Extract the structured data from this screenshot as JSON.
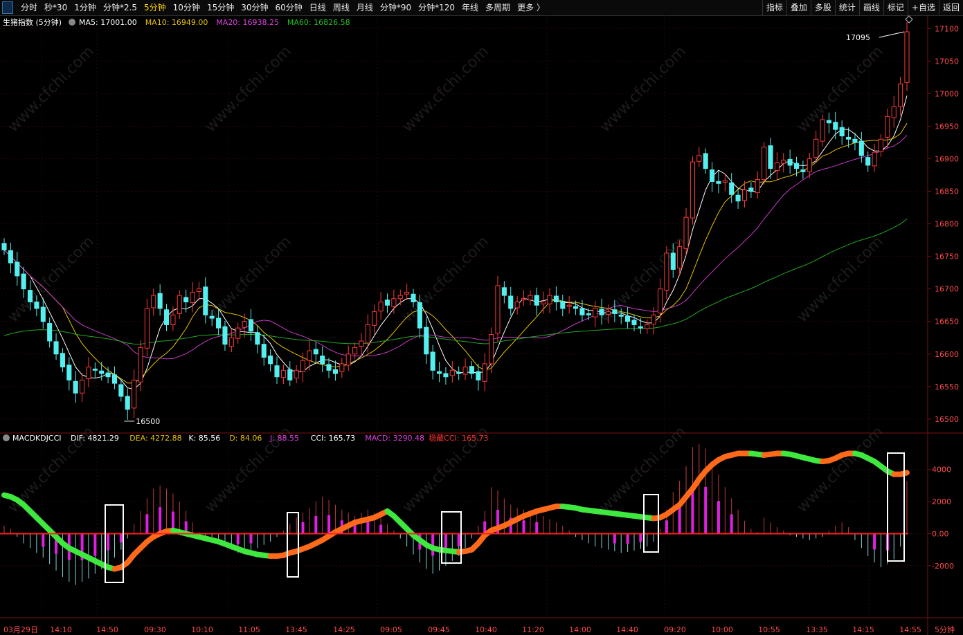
{
  "toolbar": {
    "periods": [
      "分时",
      "秒*30",
      "1分钟",
      "分钟*2.5",
      "5分钟",
      "10分钟",
      "15分钟",
      "30分钟",
      "60分钟",
      "日线",
      "周线",
      "月线",
      "分钟*90",
      "分钟*120",
      "年线",
      "多周期",
      "更多 〉"
    ],
    "active_period": "5分钟",
    "right_items": [
      "指标",
      "叠加",
      "多股",
      "统计",
      "画线",
      "标记",
      "+自选",
      "返回"
    ]
  },
  "main_panel": {
    "instrument": "生猪指数 (5分钟)",
    "ma_labels": [
      {
        "text": "MA5: 17001.00",
        "color": "#ffffff"
      },
      {
        "text": "MA10: 16949.00",
        "color": "#e6c300"
      },
      {
        "text": "MA20: 16938.25",
        "color": "#e040e0"
      },
      {
        "text": "MA60: 16826.58",
        "color": "#22c022"
      }
    ],
    "high_marker": "17095",
    "low_marker": "16500"
  },
  "indicator_panel": {
    "title": "MACDKDJCCI",
    "labels": [
      {
        "text": "DIF: 4821.29",
        "color": "#ffffff"
      },
      {
        "text": "DEA: 4272.88",
        "color": "#e6c300"
      },
      {
        "text": "K: 85.56",
        "color": "#ffffff"
      },
      {
        "text": "D: 84.06",
        "color": "#e6c300"
      },
      {
        "text": "J: 88.55",
        "color": "#e040e0"
      },
      {
        "text": "CCI: 165.73",
        "color": "#ffffff"
      },
      {
        "text": "MACD: 3290.48",
        "color": "#e040e0"
      },
      {
        "text": "稳藏CCI: 165.73",
        "color": "#ff3030"
      }
    ]
  },
  "x_axis": {
    "labels": [
      "03月29日",
      "14:10",
      "14:50",
      "09:30",
      "10:10",
      "11:05",
      "13:45",
      "14:25",
      "09:05",
      "09:45",
      "10:40",
      "11:20",
      "14:00",
      "14:40",
      "09:20",
      "10:00",
      "10:55",
      "13:35",
      "14:15",
      "14:55"
    ],
    "period_label": "5分钟"
  },
  "chart_data": {
    "type": "candlestick",
    "title": "生猪指数 (5分钟)",
    "price_axis_ticks": [
      16500,
      16550,
      16600,
      16650,
      16700,
      16750,
      16800,
      16850,
      16900,
      16950,
      17000,
      17050,
      17100
    ],
    "price_range": [
      16485,
      17112
    ],
    "indicator_axis_ticks": [
      4000,
      2000,
      0.0,
      -2000
    ],
    "indicator_tick_labels": [
      "4000",
      "2000",
      "0.00",
      "-2000"
    ],
    "indicator_range": [
      -5200,
      5800
    ],
    "close": [
      16760,
      16740,
      16720,
      16700,
      16680,
      16670,
      16650,
      16620,
      16600,
      16580,
      16560,
      16540,
      16560,
      16580,
      16575,
      16570,
      16565,
      16555,
      16535,
      16515,
      16560,
      16610,
      16670,
      16690,
      16670,
      16645,
      16660,
      16690,
      16680,
      16695,
      16700,
      16660,
      16655,
      16640,
      16615,
      16625,
      16640,
      16650,
      16635,
      16615,
      16595,
      16585,
      16565,
      16575,
      16560,
      16575,
      16590,
      16605,
      16600,
      16585,
      16575,
      16570,
      16585,
      16600,
      16610,
      16620,
      16645,
      16665,
      16680,
      16675,
      16685,
      16690,
      16695,
      16680,
      16640,
      16600,
      16575,
      16570,
      16565,
      16575,
      16570,
      16580,
      16570,
      16560,
      16585,
      16630,
      16705,
      16690,
      16670,
      16680,
      16685,
      16690,
      16675,
      16680,
      16690,
      16680,
      16670,
      16675,
      16670,
      16660,
      16660,
      16670,
      16660,
      16665,
      16662,
      16658,
      16650,
      16645,
      16640,
      16645,
      16660,
      16700,
      16755,
      16730,
      16765,
      16810,
      16895,
      16905,
      16885,
      16865,
      16862,
      16866,
      16845,
      16835,
      16852,
      16850,
      16868,
      16918,
      16885,
      16894,
      16898,
      16890,
      16885,
      16880,
      16900,
      16930,
      16960,
      16955,
      16945,
      16935,
      16930,
      16925,
      16905,
      16890,
      16910,
      16930,
      16965,
      16980,
      17015,
      17095
    ],
    "volume_note": "",
    "ma60_start": 16625,
    "indicator_series_note": "MACD histogram approximated from chart",
    "macd_hist": [
      500,
      300,
      -200,
      -600,
      -900,
      -1200,
      -1500,
      -1900,
      -2300,
      -2700,
      -3000,
      -3200,
      -3000,
      -2800,
      -2500,
      -2200,
      -1900,
      -1500,
      -1000,
      -300,
      600,
      1400,
      2200,
      2800,
      3000,
      2800,
      2500,
      2000,
      1400,
      700,
      100,
      -100,
      -200,
      -400,
      -700,
      -1000,
      -1200,
      -1300,
      -1100,
      -900,
      -700,
      -500,
      -200,
      200,
      600,
      1000,
      1300,
      1600,
      2000,
      2300,
      2100,
      1800,
      1500,
      1300,
      1100,
      1300,
      1500,
      1300,
      1000,
      600,
      200,
      -300,
      -800,
      -1300,
      -1800,
      -2200,
      -2500,
      -2300,
      -2000,
      -1700,
      -1400,
      -900,
      -300,
      500,
      1400,
      2900,
      2700,
      2200,
      1800,
      1600,
      1500,
      1400,
      1300,
      1100,
      900,
      700,
      500,
      200,
      -200,
      -400,
      -600,
      -800,
      -900,
      -1000,
      -1100,
      -1200,
      -1150,
      -1050,
      -950,
      -800,
      -500,
      300,
      1500,
      2600,
      3300,
      4200,
      5400,
      5600,
      5300,
      4500,
      3700,
      2900,
      2200,
      1500,
      800,
      300,
      100,
      1000,
      700,
      400,
      200,
      -100,
      -200,
      -300,
      -400,
      -300,
      -200,
      200,
      500,
      700,
      400,
      -400,
      -900,
      -1400,
      -1800,
      -2100,
      -1900,
      -1600,
      -800,
      3290
    ],
    "dif": [
      2400,
      2300,
      2100,
      1800,
      1400,
      1000,
      600,
      200,
      -200,
      -600,
      -900,
      -1100,
      -1300,
      -1500,
      -1700,
      -1900,
      -2100,
      -2200,
      -2100,
      -1800,
      -1300,
      -900,
      -500,
      -200,
      0,
      150,
      200,
      100,
      0,
      -100,
      -200,
      -300,
      -400,
      -500,
      -650,
      -800,
      -950,
      -1100,
      -1200,
      -1300,
      -1350,
      -1400,
      -1400,
      -1350,
      -1200,
      -1100,
      -950,
      -800,
      -600,
      -400,
      -150,
      100,
      300,
      500,
      700,
      800,
      900,
      1000,
      1200,
      1400,
      1100,
      700,
      300,
      -100,
      -400,
      -700,
      -900,
      -1000,
      -1050,
      -1100,
      -1150,
      -1100,
      -1000,
      -600,
      -100,
      200,
      350,
      500,
      700,
      900,
      1100,
      1250,
      1400,
      1500,
      1600,
      1700,
      1700,
      1650,
      1600,
      1500,
      1450,
      1400,
      1350,
      1300,
      1250,
      1200,
      1150,
      1100,
      1050,
      1000,
      950,
      1000,
      1200,
      1500,
      1800,
      2300,
      2800,
      3400,
      3900,
      4300,
      4600,
      4800,
      4900,
      5000,
      5000,
      5000,
      4950,
      4900,
      4950,
      5000,
      5000,
      4950,
      4850,
      4750,
      4650,
      4550,
      4500,
      4550,
      4700,
      4900,
      5000,
      5000,
      4900,
      4700,
      4500,
      4200,
      3900,
      3700,
      3700,
      3800,
      4100,
      4821
    ]
  }
}
